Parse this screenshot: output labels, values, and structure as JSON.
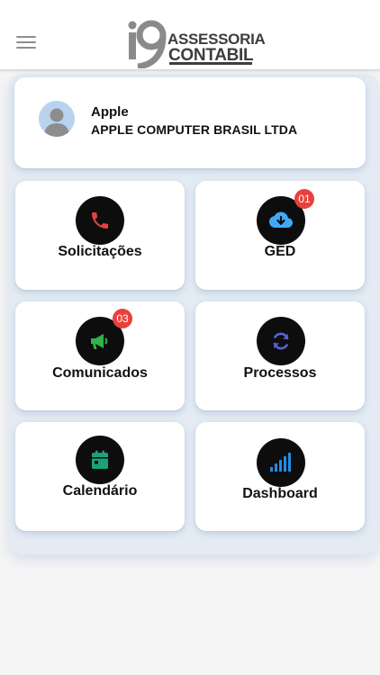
{
  "header": {
    "menu_icon": "hamburger-menu-icon",
    "logo": {
      "mark": "i9",
      "line1": "ASSESSORIA",
      "line2": "CONTABIL"
    }
  },
  "profile": {
    "name": "Apple",
    "company": "APPLE COMPUTER BRASIL LTDA",
    "avatar_icon": "user-avatar-icon"
  },
  "tiles": [
    {
      "label": "Solicitações",
      "icon": "phone-icon",
      "icon_color": "#e8413c",
      "badge": ""
    },
    {
      "label": "GED",
      "icon": "cloud-download-icon",
      "icon_color": "#3fa9f5",
      "badge": "01"
    },
    {
      "label": "Comunicados",
      "icon": "megaphone-icon",
      "icon_color": "#2fb34a",
      "badge": "03"
    },
    {
      "label": "Processos",
      "icon": "sync-icon",
      "icon_color": "#5a62d8",
      "badge": ""
    },
    {
      "label": "Calendário",
      "icon": "calendar-icon",
      "icon_color": "#1aa37a",
      "badge": ""
    },
    {
      "label": "Dashboard",
      "icon": "signal-bars-icon",
      "icon_color": "#1f8de8",
      "badge": ""
    }
  ],
  "colors": {
    "badge": "#e8413c",
    "icon_circle": "#0d0d0d",
    "background": "#f5f5f5"
  }
}
